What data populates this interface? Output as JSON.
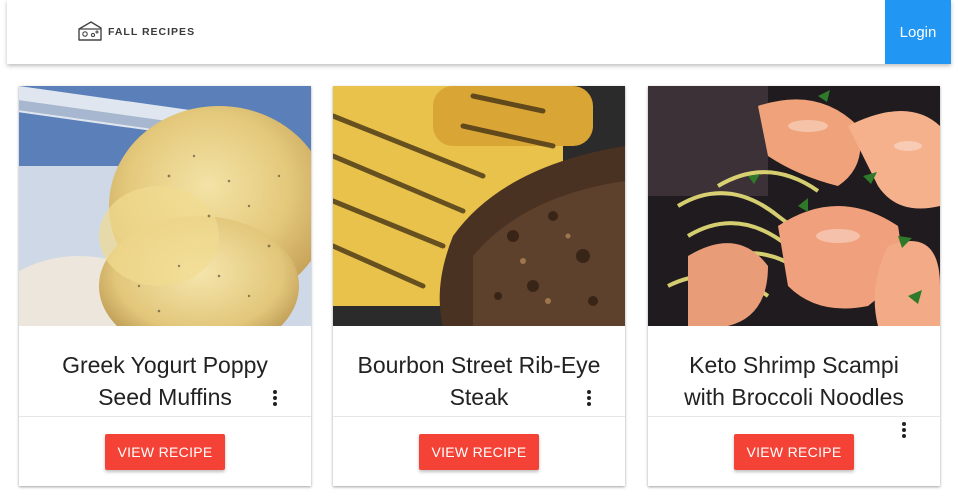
{
  "header": {
    "brand": "FALL RECIPES",
    "brand_icon": "cheese-icon",
    "login_label": "Login",
    "accent_color": "#2196f3"
  },
  "cards": [
    {
      "title_line1": "Greek Yogurt Poppy",
      "title_line2": "Seed Muffins",
      "button_label": "VIEW RECIPE",
      "menu_icon": "more-vert-icon"
    },
    {
      "title_line1": "Bourbon Street Rib-Eye",
      "title_line2": "Steak",
      "button_label": "VIEW RECIPE",
      "menu_icon": "more-vert-icon"
    },
    {
      "title_line1": "Keto Shrimp Scampi",
      "title_line2": "with Broccoli Noodles",
      "button_label": "VIEW RECIPE",
      "menu_icon": "more-vert-icon"
    }
  ],
  "button_color": "#f44336"
}
